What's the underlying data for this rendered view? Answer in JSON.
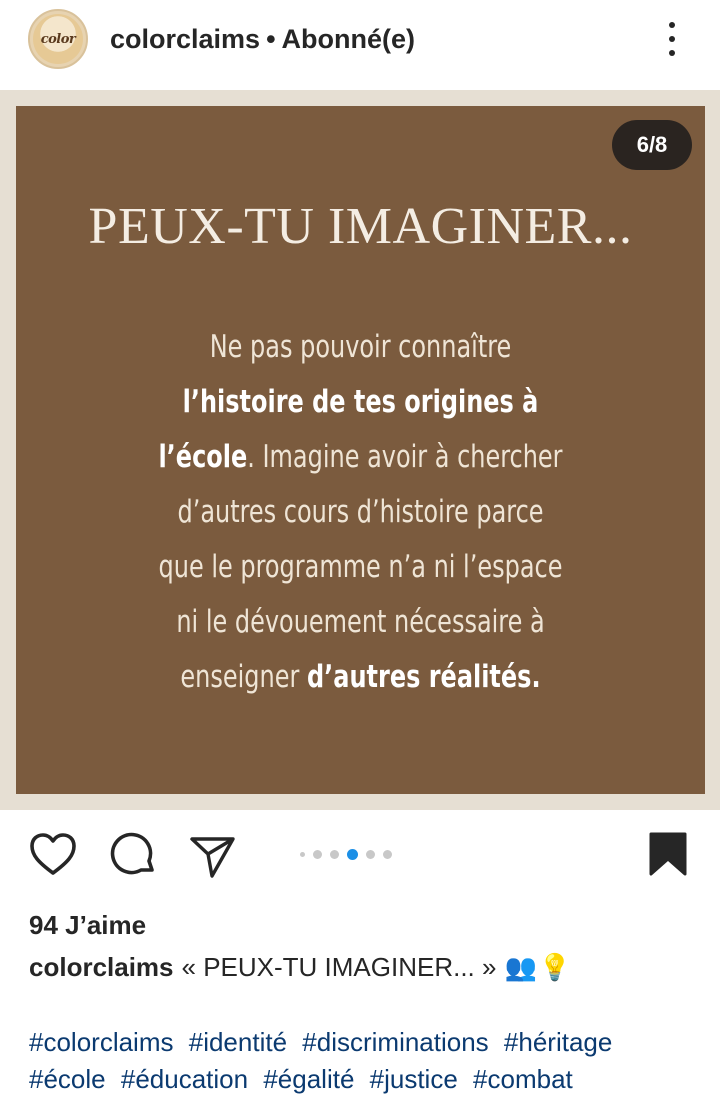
{
  "header": {
    "username": "colorclaims",
    "separator": "•",
    "follow_status": "Abonné(e)",
    "avatar_text": "color"
  },
  "post": {
    "slide_counter": "6/8",
    "title": "PEUX-TU IMAGINER...",
    "body": {
      "l1": "Ne pas pouvoir connaître",
      "l2_bold": "l’histoire de tes origines à",
      "l3_bold": "l’école",
      "l3_rest": ". Imagine avoir à chercher",
      "l4": "d’autres cours d’histoire parce",
      "l5": "que le programme n’a ni l’espace",
      "l6": "ni le dévouement nécessaire à",
      "l7_start": "enseigner ",
      "l7_bold": "d’autres réalités."
    },
    "background_color": "#7b5b3e"
  },
  "actions": {
    "like_icon": "heart-icon",
    "comment_icon": "comment-icon",
    "share_icon": "send-icon",
    "save_icon": "bookmark-icon",
    "carousel_total": 5,
    "carousel_active_index": 3,
    "active_dot_color": "#1b8fe6"
  },
  "likes": {
    "text": "94 J’aime"
  },
  "caption": {
    "username": "colorclaims",
    "text": "« PEUX-TU IMAGINER... »",
    "emoji_1": "👥",
    "emoji_2": "💡"
  },
  "hashtags": [
    "#colorclaims",
    "#identité",
    "#discriminations",
    "#héritage",
    "#école",
    "#éducation",
    "#égalité",
    "#justice",
    "#combat"
  ]
}
